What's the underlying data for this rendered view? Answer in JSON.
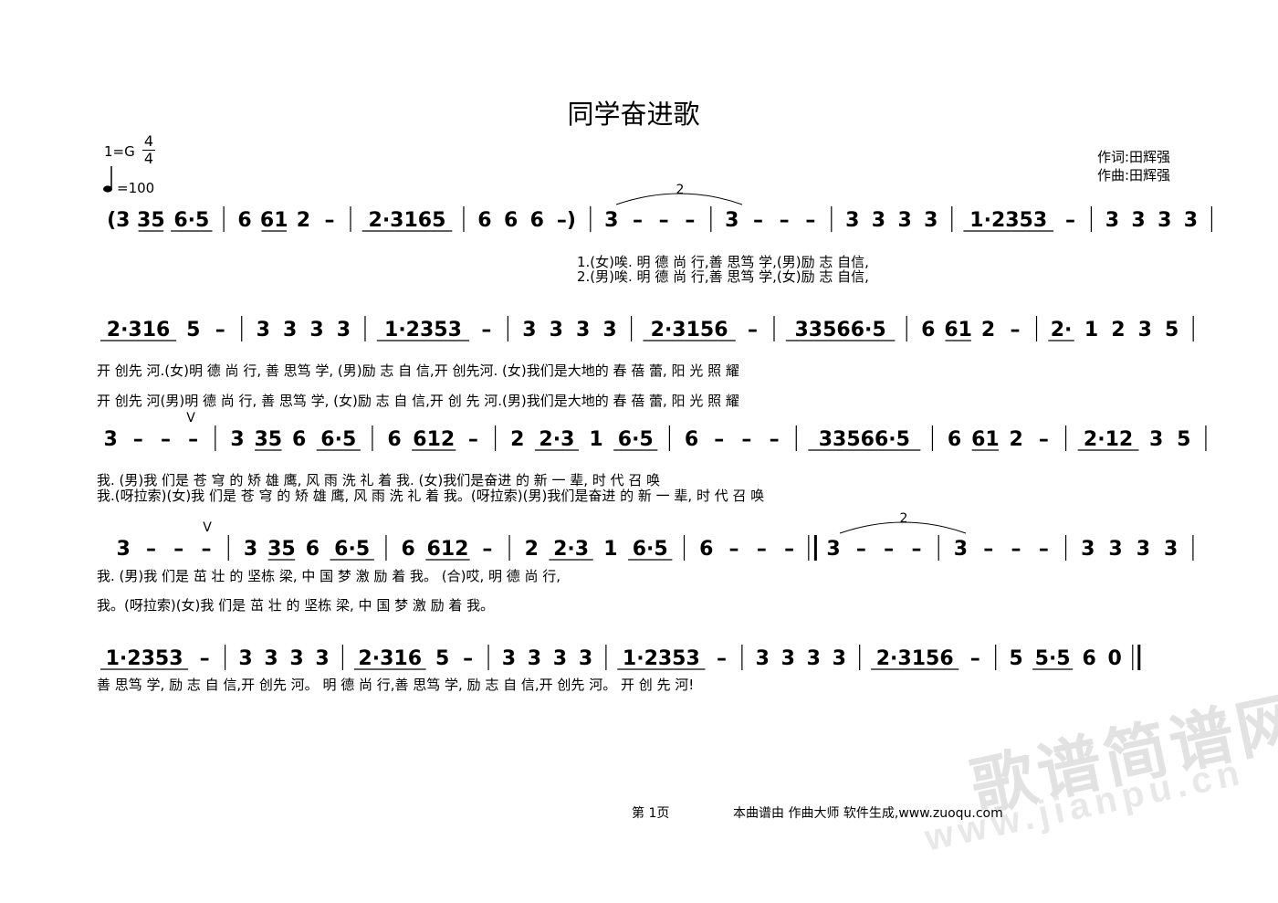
{
  "score": {
    "title": "同学奋进歌",
    "key": "1=G",
    "time_signature": {
      "top": "4",
      "bottom": "4"
    },
    "tempo": "=100",
    "lyricist": "作词:田辉强",
    "composer": "作曲:田辉强"
  },
  "systems": [
    {
      "notation": "(3 35 6·5 | 6 61 2 – | 2·3165 | 6 6 6 –) | 3 – – – | 3 – – – | 3 3 3 3 | 1·2353 – | 3 3 3 3 |",
      "tuplet_label": "2",
      "lyrics": [
        "1.(女)唉.                    明 德 尚 行,善 思笃 学,(男)励 志 自信,",
        "2.(男)唉.                    明 德 尚 行,善 思笃 学,(女)励 志 自信,"
      ]
    },
    {
      "notation": "2·316 5 – | 3 3 3 3 | 1·2353 – | 3 3 3 3 | 2·3156 – | 33566·5 | 6 61 2 – | 2· 1 2 3 5 |",
      "lyrics": [
        "开 创先  河.(女)明 德 尚 行, 善 思笃 学, (男)励 志 自 信,开 创先河. (女)我们是大地的  春 蓓 蕾,   阳  光 照 耀",
        "开 创先  河(男)明 德 尚 行, 善 思笃 学, (女)励 志 自 信,开 创 先 河.(男)我们是大地的  春 蓓 蕾,   阳  光 照 耀"
      ]
    },
    {
      "notation": "3 – – – | 3 35 6 6·5 | 6 612 – | 2 2·3 1 6·5 | 6 – – – | 33566·5 | 6 61 2 – | 2·12 3 5 |",
      "breath_mark": "V",
      "lyrics": [
        "我.      (男)我 们是 苍 穹 的  矫 雄 鹰,  风 雨   洗 礼 着 我.      (女)我们是奋进 的  新  一 辈,  时 代 召 唤",
        "我.(呀拉索)(女)我 们是 苍 穹 的  矫 雄 鹰,  风 雨   洗 礼 着 我。(呀拉索)(男)我们是奋进 的  新  一 辈,  时 代 召 唤"
      ]
    },
    {
      "notation": "3 – – – | 3 35 6 6·5 | 6 612 – | 2 2·3 1 6·5 | 6 – – – :|| 3 – – – | 3 – – – | 3 3 3 3 |",
      "breath_mark": "V",
      "tuplet_label": "2",
      "lyrics": [
        "我.       (男)我 们是 茁 壮 的 坚栋 梁,   中 国 梦   激 励 着 我。   (合)哎,                 明 德 尚 行,",
        "我。(呀拉索)(女)我 们是 茁 壮 的 坚栋 梁,   中 国 梦   激 励 着 我。"
      ]
    },
    {
      "notation": "1·2353 – | 3 3 3 3 | 2·316 5 – | 3 3 3 3 | 1·2353 – | 3 3 3 3 | 2·3156 – | 5 5·5 6 0 ||",
      "lyrics": [
        "善 思笃 学,   励 志 自 信,开 创先  河。 明 德 尚 行,善 思笃 学,   励 志 自 信,开 创先 河。  开 创 先 河!"
      ]
    }
  ],
  "footer": {
    "page": "第 1页",
    "credit": "本曲谱由 作曲大师 软件生成,www.zuoqu.com"
  },
  "watermark": {
    "line1": "歌谱简谱网",
    "line2": "www.jianpu.cn"
  }
}
